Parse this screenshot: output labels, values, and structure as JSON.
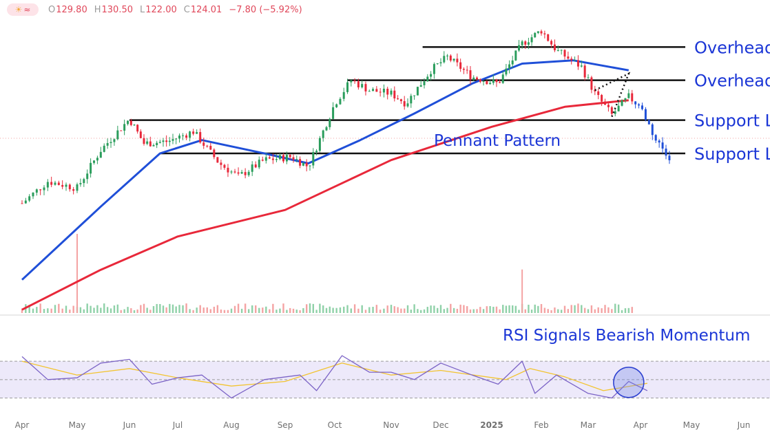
{
  "ohlc": {
    "open": "129.80",
    "high": "130.50",
    "low": "122.00",
    "close": "124.01",
    "change": "−7.80 (−5.92%)",
    "logo_icon": "sun-cloud-and-wave-logo-icon"
  },
  "chart_data": {
    "type": "line",
    "x_ticks": [
      "Apr",
      "May",
      "Jun",
      "Jul",
      "Aug",
      "Sep",
      "Oct",
      "Nov",
      "Dec",
      "2025",
      "Feb",
      "Mar",
      "Apr",
      "May",
      "Jun"
    ],
    "colors": {
      "ma50": "#1f4fd8",
      "ma200": "#e8283a",
      "up": "#2a9d5c",
      "down": "#e8283a",
      "rsi": "#7b63c6",
      "rsi_ma": "#f2c430",
      "annotation": "#1b36d6"
    },
    "price_levels": [
      {
        "label": "Overhead Resistance",
        "value": 135.0
      },
      {
        "label": "Overhead Resistance",
        "value": 130.0
      },
      {
        "label": "Support Level",
        "value": 124.0
      },
      {
        "label": "Support Level",
        "value": 119.0
      }
    ],
    "annotations": {
      "pattern": "Pennant Pattern",
      "rsi": "RSI Signals Bearish Momentum"
    },
    "price_scale": {
      "min": 95,
      "max": 140
    },
    "price": [
      {
        "t": "2024-04-01",
        "v": 111.5
      },
      {
        "t": "2024-04-15",
        "v": 114.8
      },
      {
        "t": "2024-05-01",
        "v": 113.8
      },
      {
        "t": "2024-05-15",
        "v": 119.5
      },
      {
        "t": "2024-06-01",
        "v": 124.2
      },
      {
        "t": "2024-06-10",
        "v": 120.5
      },
      {
        "t": "2024-06-25",
        "v": 120.8
      },
      {
        "t": "2024-07-10",
        "v": 122.3
      },
      {
        "t": "2024-07-25",
        "v": 117.5
      },
      {
        "t": "2024-08-05",
        "v": 115.5
      },
      {
        "t": "2024-08-20",
        "v": 118.0
      },
      {
        "t": "2024-09-05",
        "v": 118.5
      },
      {
        "t": "2024-09-15",
        "v": 117.0
      },
      {
        "t": "2024-10-01",
        "v": 126.5
      },
      {
        "t": "2024-10-10",
        "v": 130.0
      },
      {
        "t": "2024-10-20",
        "v": 128.5
      },
      {
        "t": "2024-11-01",
        "v": 128.0
      },
      {
        "t": "2024-11-10",
        "v": 126.5
      },
      {
        "t": "2024-11-25",
        "v": 131.5
      },
      {
        "t": "2024-12-05",
        "v": 133.5
      },
      {
        "t": "2024-12-20",
        "v": 130.5
      },
      {
        "t": "2025-01-05",
        "v": 129.5
      },
      {
        "t": "2025-01-20",
        "v": 135.5
      },
      {
        "t": "2025-02-01",
        "v": 137.5
      },
      {
        "t": "2025-02-10",
        "v": 134.5
      },
      {
        "t": "2025-02-25",
        "v": 132.0
      },
      {
        "t": "2025-03-05",
        "v": 128.0
      },
      {
        "t": "2025-03-15",
        "v": 124.8
      },
      {
        "t": "2025-03-25",
        "v": 127.5
      },
      {
        "t": "2025-04-01",
        "v": 126.0
      },
      {
        "t": "2025-04-10",
        "v": 121.0
      },
      {
        "t": "2025-04-18",
        "v": 118.5
      }
    ],
    "ma50": [
      {
        "t": "2024-04-01",
        "v": 100.0
      },
      {
        "t": "2024-05-15",
        "v": 111.0
      },
      {
        "t": "2024-06-20",
        "v": 119.0
      },
      {
        "t": "2024-07-15",
        "v": 121.0
      },
      {
        "t": "2024-08-20",
        "v": 119.0
      },
      {
        "t": "2024-09-15",
        "v": 117.5
      },
      {
        "t": "2024-10-15",
        "v": 121.0
      },
      {
        "t": "2024-11-15",
        "v": 125.0
      },
      {
        "t": "2024-12-20",
        "v": 129.5
      },
      {
        "t": "2025-01-20",
        "v": 132.5
      },
      {
        "t": "2025-02-20",
        "v": 133.0
      },
      {
        "t": "2025-03-25",
        "v": 131.5
      }
    ],
    "ma200": [
      {
        "t": "2024-04-01",
        "v": 95.5
      },
      {
        "t": "2024-05-15",
        "v": 101.5
      },
      {
        "t": "2024-07-01",
        "v": 106.5
      },
      {
        "t": "2024-09-01",
        "v": 110.5
      },
      {
        "t": "2024-11-01",
        "v": 118.0
      },
      {
        "t": "2025-01-01",
        "v": 123.0
      },
      {
        "t": "2025-02-15",
        "v": 126.0
      },
      {
        "t": "2025-03-25",
        "v": 127.0
      }
    ],
    "rsi_scale": {
      "min": 20,
      "max": 85,
      "bands": [
        30,
        50,
        70
      ]
    },
    "rsi": [
      {
        "t": "2024-04-01",
        "v": 75
      },
      {
        "t": "2024-04-15",
        "v": 50
      },
      {
        "t": "2024-05-01",
        "v": 52
      },
      {
        "t": "2024-05-15",
        "v": 68
      },
      {
        "t": "2024-06-01",
        "v": 72
      },
      {
        "t": "2024-06-15",
        "v": 45
      },
      {
        "t": "2024-07-01",
        "v": 52
      },
      {
        "t": "2024-07-15",
        "v": 55
      },
      {
        "t": "2024-08-01",
        "v": 30
      },
      {
        "t": "2024-08-20",
        "v": 50
      },
      {
        "t": "2024-09-10",
        "v": 55
      },
      {
        "t": "2024-09-20",
        "v": 38
      },
      {
        "t": "2024-10-05",
        "v": 76
      },
      {
        "t": "2024-10-20",
        "v": 58
      },
      {
        "t": "2024-11-01",
        "v": 58
      },
      {
        "t": "2024-11-15",
        "v": 50
      },
      {
        "t": "2024-12-01",
        "v": 68
      },
      {
        "t": "2024-12-20",
        "v": 55
      },
      {
        "t": "2025-01-05",
        "v": 45
      },
      {
        "t": "2025-01-20",
        "v": 70
      },
      {
        "t": "2025-01-28",
        "v": 35
      },
      {
        "t": "2025-02-10",
        "v": 55
      },
      {
        "t": "2025-03-01",
        "v": 35
      },
      {
        "t": "2025-03-15",
        "v": 30
      },
      {
        "t": "2025-03-25",
        "v": 48
      },
      {
        "t": "2025-04-05",
        "v": 38
      }
    ],
    "rsi_ma": [
      {
        "t": "2024-04-01",
        "v": 70
      },
      {
        "t": "2024-05-01",
        "v": 55
      },
      {
        "t": "2024-06-01",
        "v": 62
      },
      {
        "t": "2024-07-01",
        "v": 52
      },
      {
        "t": "2024-08-01",
        "v": 43
      },
      {
        "t": "2024-09-01",
        "v": 48
      },
      {
        "t": "2024-10-05",
        "v": 68
      },
      {
        "t": "2024-11-01",
        "v": 55
      },
      {
        "t": "2024-12-01",
        "v": 60
      },
      {
        "t": "2025-01-10",
        "v": 50
      },
      {
        "t": "2025-01-25",
        "v": 62
      },
      {
        "t": "2025-02-15",
        "v": 53
      },
      {
        "t": "2025-03-10",
        "v": 38
      },
      {
        "t": "2025-04-05",
        "v": 46
      }
    ],
    "volume_spikes": [
      {
        "t": "2024-05-01",
        "v": 1.0
      },
      {
        "t": "2025-01-20",
        "v": 0.55
      }
    ]
  }
}
